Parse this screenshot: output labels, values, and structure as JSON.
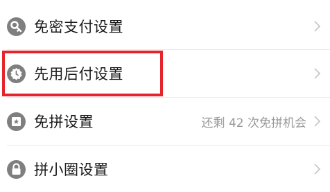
{
  "settings": {
    "items": [
      {
        "label": "免密支付设置",
        "value": "",
        "icon": "key-icon"
      },
      {
        "label": "先用后付设置",
        "value": "",
        "icon": "badge-icon"
      },
      {
        "label": "免拼设置",
        "value": "还剩 42 次免拼机会",
        "icon": "ticket-icon"
      },
      {
        "label": "拼小圈设置",
        "value": "",
        "icon": "lock-icon"
      }
    ]
  },
  "colors": {
    "highlight_border": "#e5242b",
    "icon_gray": "#7f7f7f",
    "value_gray": "#999999",
    "chevron_gray": "#c8c8c8"
  }
}
